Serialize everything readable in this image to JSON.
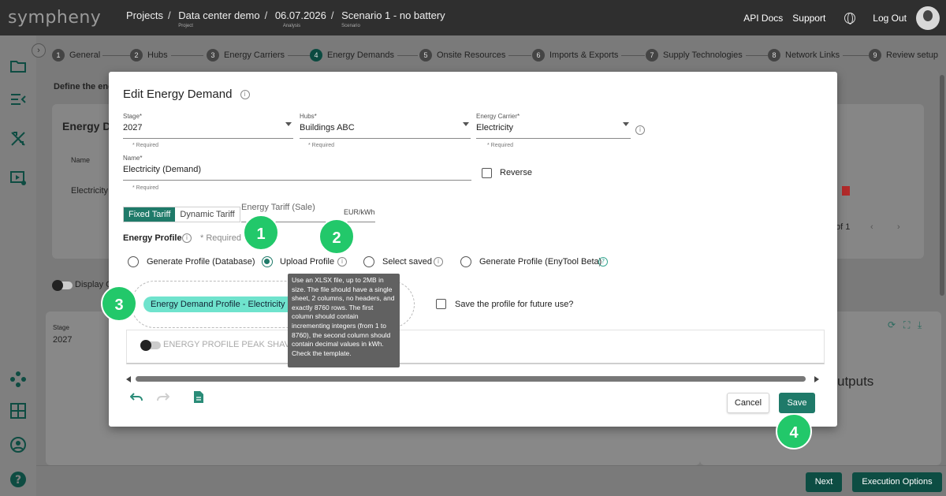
{
  "app": {
    "logo": "sympheny",
    "breadcrumb": [
      {
        "label": "Projects",
        "sub": ""
      },
      {
        "label": "Data center demo",
        "sub": "Project"
      },
      {
        "label": "06.07.2026",
        "sub": "Analysis"
      },
      {
        "label": "Scenario 1 - no battery",
        "sub": "Scenario"
      }
    ],
    "top_links": {
      "api": "API Docs",
      "support": "Support",
      "logout": "Log Out"
    }
  },
  "steps": [
    {
      "num": "1",
      "label": "General"
    },
    {
      "num": "2",
      "label": "Hubs"
    },
    {
      "num": "3",
      "label": "Energy Carriers"
    },
    {
      "num": "4",
      "label": "Energy Demands"
    },
    {
      "num": "5",
      "label": "Onsite Resources"
    },
    {
      "num": "6",
      "label": "Imports & Exports"
    },
    {
      "num": "7",
      "label": "Supply Technologies"
    },
    {
      "num": "8",
      "label": "Network Links"
    },
    {
      "num": "9",
      "label": "Review setup"
    }
  ],
  "background": {
    "define_text": "Define the ener",
    "card_title": "Energy De",
    "col_name": "Name",
    "row_name": "Electricity",
    "pager": "of 1",
    "display_toggle": "Display G",
    "stage_label": "Stage",
    "stage_value": "2027",
    "outputs": "utputs",
    "next": "Next",
    "execution": "Execution Options"
  },
  "modal": {
    "title": "Edit Energy Demand",
    "stage": {
      "label": "Stage*",
      "value": "2027",
      "required": "* Required"
    },
    "hubs": {
      "label": "Hubs*",
      "value": "Buildings ABC",
      "required": "* Required"
    },
    "carrier": {
      "label": "Energy Carrier*",
      "value": "Electricity",
      "required": "* Required"
    },
    "name": {
      "label": "Name*",
      "value": "Electricity (Demand)",
      "required": "* Required"
    },
    "reverse": "Reverse",
    "tariff_tabs": {
      "fixed": "Fixed Tariff",
      "dynamic": "Dynamic Tariff"
    },
    "tariff_field": {
      "placeholder": "Energy Tariff (Sale)",
      "unit": "EUR/kWh"
    },
    "profile_label": "Energy Profile",
    "profile_required": "* Required",
    "radios": {
      "database": "Generate Profile (Database)",
      "upload": "Upload Profile",
      "saved": "Select saved",
      "enytool": "Generate Profile (EnyTool Beta)"
    },
    "chip": "Energy Demand Profile - Electricity data",
    "save_future": "Save the profile for future use?",
    "peak_shaving": "ENERGY PROFILE PEAK SHAVING",
    "tooltip": "Use an XLSX file, up to 2MB in size. The file should have a single sheet, 2 columns, no headers, and exactly 8760 rows. The first column should contain incrementing integers (from 1 to 8760), the second column should contain decimal values in kWh. Check the template.",
    "cancel": "Cancel",
    "save": "Save"
  },
  "annotations": [
    "1",
    "2",
    "3",
    "4"
  ],
  "colors": {
    "accent": "#1f7a69",
    "chip": "#6fe3cd",
    "badge": "#22c86a",
    "topbar": "#2f2f2f"
  }
}
